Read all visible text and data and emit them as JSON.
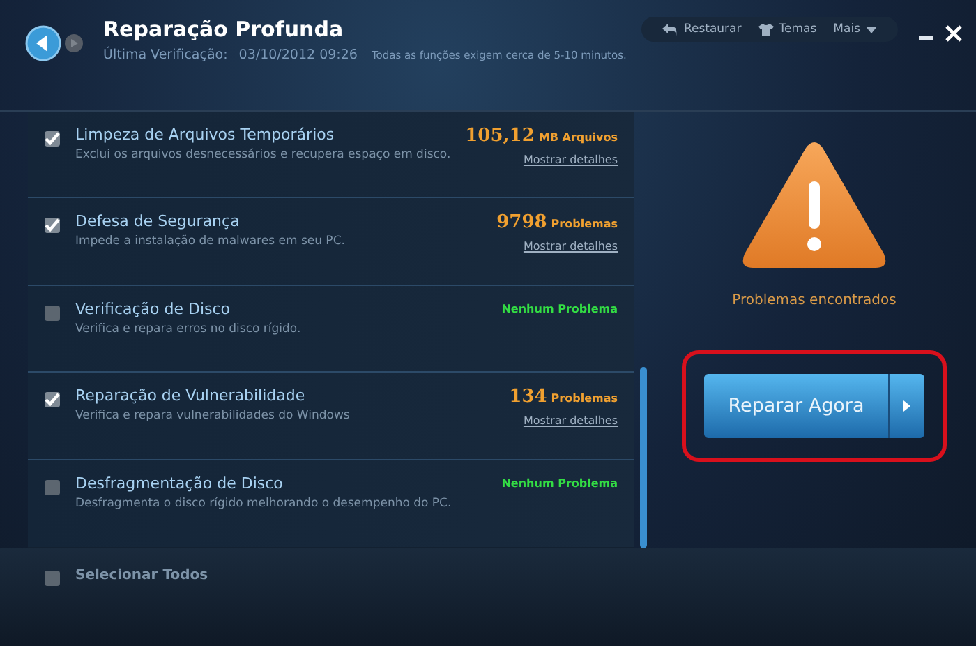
{
  "window": {
    "title": "Reparação Profunda",
    "last_check_label": "Última Verificação:",
    "last_check_value": "03/10/2012 09:26",
    "note": "Todas as funções exigem cerca de 5-10 minutos."
  },
  "toolbar": [
    {
      "label": "Restaurar",
      "kind": "restore"
    },
    {
      "label": "Temas",
      "kind": "themes"
    },
    {
      "label": "Mais",
      "kind": "more"
    }
  ],
  "items": [
    {
      "title": "Limpeza de Arquivos Temporários",
      "description": "Exclui os arquivos desnecessários e recupera espaço em disco.",
      "checked": true,
      "result": {
        "kind": "count",
        "value": "105,12",
        "unit": "MB Arquivos",
        "link": "Mostrar detalhes"
      }
    },
    {
      "title": "Defesa de Segurança",
      "description": "Impede a instalação de malwares em seu PC.",
      "checked": true,
      "result": {
        "kind": "count",
        "value": "9798",
        "unit": "Problemas",
        "link": "Mostrar detalhes"
      }
    },
    {
      "title": "Verificação de Disco",
      "description": "Verifica e repara erros no disco rígido.",
      "checked": false,
      "result": {
        "kind": "ok",
        "text": "Nenhum Problema"
      }
    },
    {
      "title": "Reparação de Vulnerabilidade",
      "description": "Verifica e repara vulnerabilidades do Windows",
      "checked": true,
      "result": {
        "kind": "count",
        "value": "134",
        "unit": "Problemas",
        "link": "Mostrar detalhes"
      }
    },
    {
      "title": "Desfragmentação de Disco",
      "description": "Desfragmenta o disco rígido melhorando o desempenho do PC.",
      "checked": false,
      "result": {
        "kind": "ok",
        "text": "Nenhum Problema"
      }
    }
  ],
  "select_all": {
    "label": "Selecionar Todos",
    "checked": false
  },
  "status": {
    "text": "Problemas encontrados"
  },
  "action_button": {
    "label": "Reparar Agora",
    "highlighted": true
  }
}
